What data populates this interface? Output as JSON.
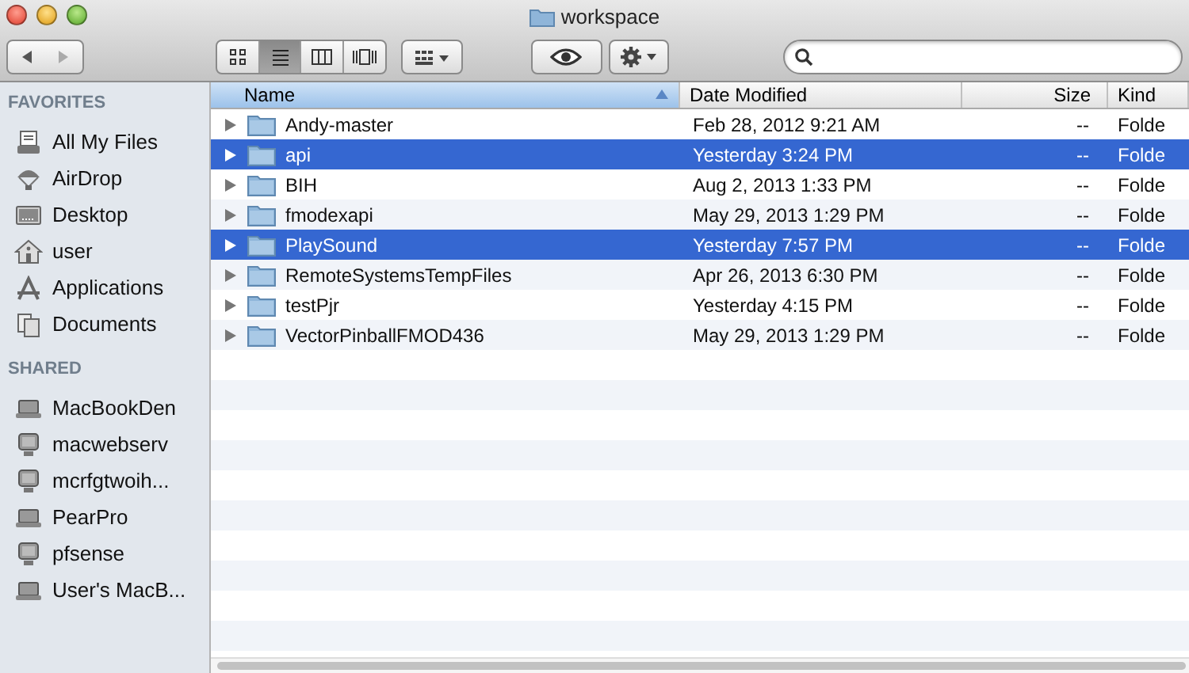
{
  "window": {
    "title": "workspace"
  },
  "toolbar": {
    "view_modes": [
      {
        "kind": "icons",
        "selected": false
      },
      {
        "kind": "list",
        "selected": true
      },
      {
        "kind": "columns",
        "selected": false
      },
      {
        "kind": "coverflow",
        "selected": false
      }
    ]
  },
  "sidebar": {
    "sections": [
      {
        "title": "FAVORITES",
        "items": [
          {
            "label": "All My Files",
            "kind": "files"
          },
          {
            "label": "AirDrop",
            "kind": "airdrop"
          },
          {
            "label": "Desktop",
            "kind": "desktop"
          },
          {
            "label": "user",
            "kind": "home"
          },
          {
            "label": "Applications",
            "kind": "apps"
          },
          {
            "label": "Documents",
            "kind": "docs"
          }
        ]
      },
      {
        "title": "SHARED",
        "items": [
          {
            "label": "MacBookDen",
            "kind": "laptop"
          },
          {
            "label": "macwebserv",
            "kind": "monitor"
          },
          {
            "label": "mcrfgtwoih...",
            "kind": "monitor"
          },
          {
            "label": "PearPro",
            "kind": "laptop"
          },
          {
            "label": "pfsense",
            "kind": "monitor"
          },
          {
            "label": "User's MacB...",
            "kind": "laptop"
          }
        ]
      }
    ]
  },
  "table": {
    "columns": [
      {
        "label": "Name",
        "selected": true
      },
      {
        "label": "Date Modified",
        "selected": false
      },
      {
        "label": "Size",
        "selected": false
      },
      {
        "label": "Kind",
        "selected": false
      }
    ],
    "rows": [
      {
        "name": "Andy-master",
        "date": "Feb 28, 2012 9:21 AM",
        "size": "--",
        "kind": "Folde",
        "selected": false
      },
      {
        "name": "api",
        "date": "Yesterday 3:24 PM",
        "size": "--",
        "kind": "Folde",
        "selected": true
      },
      {
        "name": "BIH",
        "date": "Aug 2, 2013 1:33 PM",
        "size": "--",
        "kind": "Folde",
        "selected": false
      },
      {
        "name": "fmodexapi",
        "date": "May 29, 2013 1:29 PM",
        "size": "--",
        "kind": "Folde",
        "selected": false
      },
      {
        "name": "PlaySound",
        "date": "Yesterday 7:57 PM",
        "size": "--",
        "kind": "Folde",
        "selected": true
      },
      {
        "name": "RemoteSystemsTempFiles",
        "date": "Apr 26, 2013 6:30 PM",
        "size": "--",
        "kind": "Folde",
        "selected": false
      },
      {
        "name": "testPjr",
        "date": "Yesterday 4:15 PM",
        "size": "--",
        "kind": "Folde",
        "selected": false
      },
      {
        "name": "VectorPinballFMOD436",
        "date": "May 29, 2013 1:29 PM",
        "size": "--",
        "kind": "Folde",
        "selected": false
      }
    ]
  }
}
